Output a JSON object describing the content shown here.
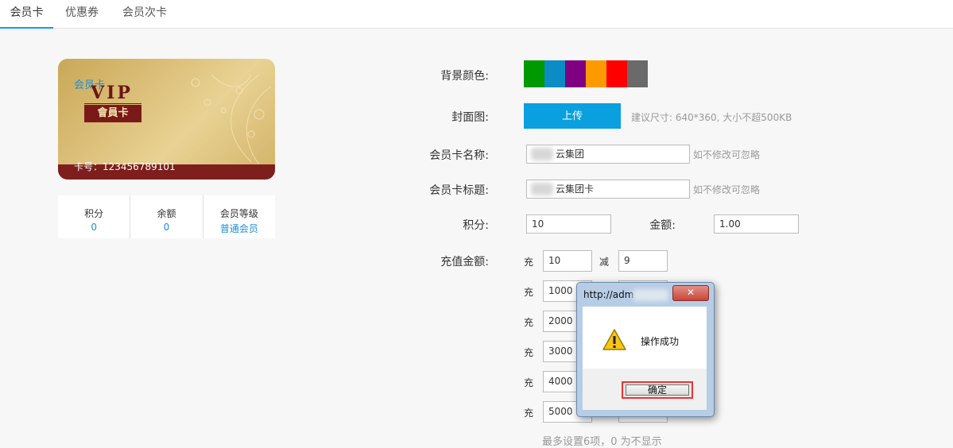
{
  "tabs": [
    {
      "label": "会员卡"
    },
    {
      "label": "优惠券"
    },
    {
      "label": "会员次卡"
    }
  ],
  "card": {
    "title": "会员卡",
    "vip_text": "VIP",
    "vip_band": "會員卡",
    "number_text": "卡号：123456789101"
  },
  "stats": [
    {
      "label": "积分",
      "value": "0"
    },
    {
      "label": "余额",
      "value": "0"
    },
    {
      "label": "会员等级",
      "value": "普通会员"
    }
  ],
  "form": {
    "bg_color_label": "背景颜色:",
    "colors": [
      "#009900",
      "#0b8cc4",
      "#7f0080",
      "#ff9900",
      "#ff0000",
      "#6a6a6a"
    ],
    "cover_label": "封面图:",
    "upload_label": "上传",
    "cover_hint": "建议尺寸: 640*360, 大小不超500KB",
    "name_label": "会员卡名称:",
    "name_value": "云集团",
    "name_hint": "如不修改可忽略",
    "subtitle_label": "会员卡标题:",
    "subtitle_value": "云集团卡",
    "subtitle_hint": "如不修改可忽略",
    "points_label": "积分:",
    "points_value": "10",
    "amount_label": "金额:",
    "amount_value": "1.00",
    "recharge_label": "充值金额:",
    "charge_char": "充",
    "reduce_char": "减",
    "recharge_rows": [
      {
        "charge": "10",
        "reduce": "9"
      },
      {
        "charge": "1000",
        "reduce": ""
      },
      {
        "charge": "2000",
        "reduce": ""
      },
      {
        "charge": "3000",
        "reduce": ""
      },
      {
        "charge": "4000",
        "reduce": ""
      },
      {
        "charge": "5000",
        "reduce": ""
      }
    ],
    "recharge_hint": "最多设置6项，0 为不显示"
  },
  "dialog": {
    "title": "http://adm",
    "close": "✕",
    "message": "操作成功",
    "ok": "确定"
  }
}
